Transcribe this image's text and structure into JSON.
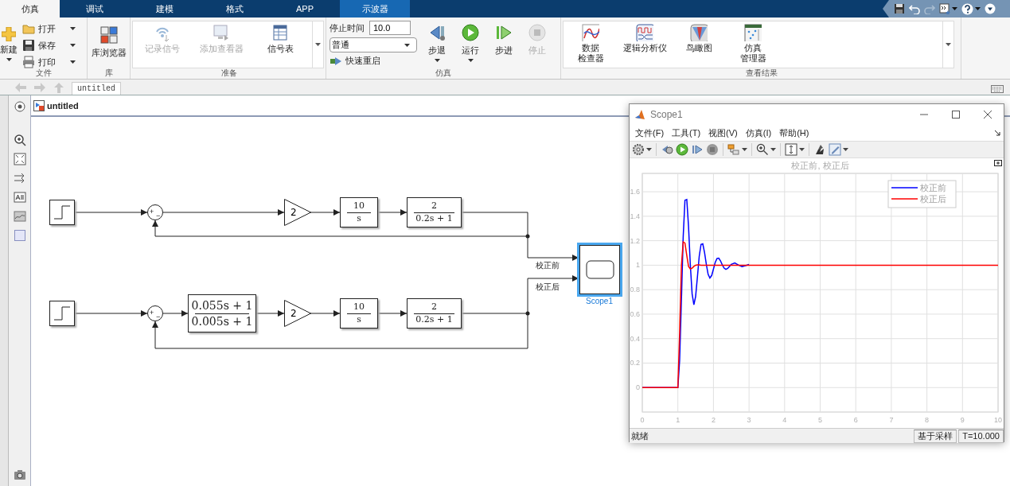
{
  "ribbon_tabs": [
    {
      "label": "仿真",
      "selected": true,
      "contextual": false
    },
    {
      "label": "调试",
      "selected": false,
      "contextual": false
    },
    {
      "label": "建模",
      "selected": false,
      "contextual": false
    },
    {
      "label": "格式",
      "selected": false,
      "contextual": false
    },
    {
      "label": "APP",
      "selected": false,
      "contextual": false
    },
    {
      "label": "示波器",
      "selected": false,
      "contextual": true
    }
  ],
  "ribbon": {
    "file": {
      "title": "文件",
      "new_label": "新建",
      "items": [
        {
          "label": "打开"
        },
        {
          "label": "保存"
        },
        {
          "label": "打印"
        }
      ]
    },
    "library": {
      "title": "库",
      "label": "库浏览器"
    },
    "prepare": {
      "title": "准备",
      "items": [
        {
          "label": "记录信号",
          "disabled": true
        },
        {
          "label": "添加查看器",
          "disabled": true
        },
        {
          "label": "信号表",
          "disabled": false
        }
      ]
    },
    "simulation": {
      "title": "仿真",
      "stop_time_label": "停止时间",
      "stop_time": "10.0",
      "mode": "普通",
      "fast_restart": "快速重启",
      "buttons": [
        {
          "label": "步退",
          "disabled": false,
          "has_menu": true
        },
        {
          "label": "运行",
          "disabled": false,
          "has_menu": true
        },
        {
          "label": "步进",
          "disabled": false,
          "has_menu": false
        },
        {
          "label": "停止",
          "disabled": true,
          "has_menu": false
        }
      ]
    },
    "results": {
      "title": "查看结果",
      "items": [
        {
          "lines": [
            "数据",
            "检查器"
          ]
        },
        {
          "lines": [
            "逻辑分析仪"
          ]
        },
        {
          "lines": [
            "鸟瞰图"
          ]
        },
        {
          "lines": [
            "仿真",
            "管理器"
          ]
        }
      ]
    }
  },
  "address_tab": "untitled",
  "breadcrumb": "untitled",
  "model": {
    "rows": [
      {
        "blocks": [
          {
            "kind": "step"
          },
          {
            "kind": "sum",
            "signs": [
              "+",
              "−"
            ]
          },
          {
            "kind": "gain",
            "value": "2"
          },
          {
            "kind": "tf",
            "num": "10",
            "den": "s"
          },
          {
            "kind": "tf",
            "num": "2",
            "den": "0.2s + 1"
          }
        ]
      },
      {
        "blocks": [
          {
            "kind": "step"
          },
          {
            "kind": "sum",
            "signs": [
              "+",
              "−"
            ]
          },
          {
            "kind": "tf",
            "num": "0.055s + 1",
            "den": "0.005s + 1"
          },
          {
            "kind": "gain",
            "value": "2"
          },
          {
            "kind": "tf",
            "num": "10",
            "den": "s"
          },
          {
            "kind": "tf",
            "num": "2",
            "den": "0.2s + 1"
          }
        ]
      }
    ],
    "signal_labels": [
      "校正前",
      "校正后"
    ],
    "scope": {
      "name": "Scope1",
      "selected": true
    }
  },
  "scope_window": {
    "title": "Scope1",
    "menu": [
      "文件(F)",
      "工具(T)",
      "视图(V)",
      "仿真(I)",
      "帮助(H)"
    ],
    "status": "就绪",
    "status_fields": [
      "基于采样",
      "T=10.000"
    ],
    "chart_data": {
      "type": "line",
      "title": "校正前, 校正后",
      "x": [
        0,
        1,
        1.05,
        1.1,
        1.15,
        1.2,
        1.25,
        1.3,
        1.35,
        1.4,
        1.45,
        1.5,
        1.55,
        1.6,
        1.65,
        1.7,
        1.75,
        1.8,
        1.85,
        1.9,
        1.95,
        2,
        2.05,
        2.1,
        2.15,
        2.2,
        2.25,
        2.3,
        2.35,
        2.4,
        2.45,
        2.5,
        2.6,
        2.7,
        2.8,
        2.9,
        3,
        4,
        5,
        6,
        7,
        8,
        9,
        10
      ],
      "series": [
        {
          "name": "校正前",
          "color": "#0000ff",
          "values": [
            0,
            0,
            0.221,
            0.725,
            1.233,
            1.531,
            1.537,
            1.316,
            1.008,
            0.766,
            0.676,
            0.744,
            0.906,
            1.071,
            1.17,
            1.175,
            1.104,
            1.005,
            0.926,
            0.895,
            0.916,
            0.968,
            1.022,
            1.055,
            1.057,
            1.035,
            1.002,
            0.976,
            0.966,
            0.973,
            0.989,
            1.007,
            1.019,
            1.001,
            0.989,
            0.996,
            1.006,
            null,
            null,
            null,
            null,
            null,
            null,
            null
          ]
        },
        {
          "name": "校正后",
          "color": "#ff0000",
          "values": [
            0,
            0,
            0.45,
            1,
            1.19,
            1.18,
            1.08,
            0.99,
            0.97,
            0.975,
            0.99,
            1,
            1.003,
            1.002,
            1,
            1,
            1,
            1,
            1,
            1,
            1,
            1,
            1,
            1,
            1,
            1,
            1,
            1,
            1,
            1,
            1,
            1,
            1,
            1,
            1,
            1,
            1,
            1,
            1,
            1,
            1,
            1,
            1,
            1
          ]
        }
      ],
      "xlim": [
        0,
        10
      ],
      "ylim": [
        -0.2,
        1.75
      ],
      "grid": true,
      "legend": "upper right",
      "xticks": [
        {
          "value": 0,
          "label": "0"
        },
        {
          "value": 1,
          "label": "1"
        },
        {
          "value": 2,
          "label": "2"
        },
        {
          "value": 3,
          "label": "3"
        },
        {
          "value": 4,
          "label": "4"
        },
        {
          "value": 5,
          "label": "5"
        },
        {
          "value": 6,
          "label": "6"
        },
        {
          "value": 7,
          "label": "7"
        },
        {
          "value": 8,
          "label": "8"
        },
        {
          "value": 9,
          "label": "9"
        },
        {
          "value": 10,
          "label": "10"
        }
      ],
      "yticks": [
        {
          "value": 0,
          "label": "0"
        },
        {
          "value": 0.2,
          "label": "0.2"
        },
        {
          "value": 0.4,
          "label": "0.4"
        },
        {
          "value": 0.6,
          "label": "0.6"
        },
        {
          "value": 0.8,
          "label": "0.8"
        },
        {
          "value": 1,
          "label": "1"
        },
        {
          "value": 1.2,
          "label": "1.2"
        },
        {
          "value": 1.4,
          "label": "1.4"
        },
        {
          "value": 1.6,
          "label": "1.6"
        }
      ]
    }
  }
}
